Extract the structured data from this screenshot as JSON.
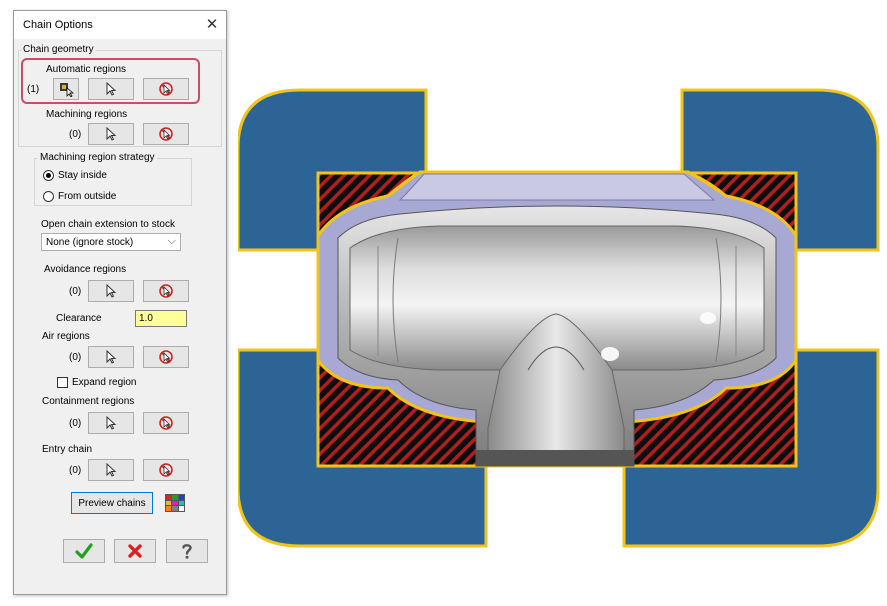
{
  "dialog": {
    "title": "Chain Options",
    "close_glyph": "✕",
    "chain_geometry": {
      "label": "Chain geometry",
      "automatic_regions": {
        "label": "Automatic regions",
        "count": "(1)"
      },
      "machining_regions": {
        "label": "Machining regions",
        "count": "(0)"
      }
    },
    "machining_region_strategy": {
      "label": "Machining region strategy",
      "options": [
        {
          "label": "Stay inside",
          "selected": true
        },
        {
          "label": "From outside",
          "selected": false
        }
      ]
    },
    "open_chain_extension": {
      "label": "Open chain extension to stock",
      "selected": "None (ignore stock)"
    },
    "avoidance_regions": {
      "label": "Avoidance regions",
      "count": "(0)"
    },
    "clearance": {
      "label": "Clearance",
      "value": "1.0"
    },
    "air_regions": {
      "label": "Air regions",
      "count": "(0)"
    },
    "expand_region": {
      "label": "Expand region",
      "checked": false
    },
    "containment_regions": {
      "label": "Containment regions",
      "count": "(0)"
    },
    "entry_chain": {
      "label": "Entry chain",
      "count": "(0)"
    },
    "preview_chains_label": "Preview chains",
    "icons": {
      "auto_select": "auto-region-select-icon",
      "select": "arrow-select-icon",
      "clear": "clear-selection-icon",
      "color_grid": "color-grid-icon",
      "ok": "checkmark-icon",
      "cancel": "red-x-icon",
      "help": "question-mark-icon"
    }
  },
  "colors": {
    "dialog_bg": "#f0f0f0",
    "highlight_border": "#d04a6a",
    "clearance_bg": "#ffff99",
    "region_blue": "#2d6496",
    "region_outline": "#f2c419",
    "hatch_red": "#b01e1e",
    "part_lavender": "#a8a8d4",
    "ok_green": "#22a022",
    "cancel_red": "#e02020"
  }
}
